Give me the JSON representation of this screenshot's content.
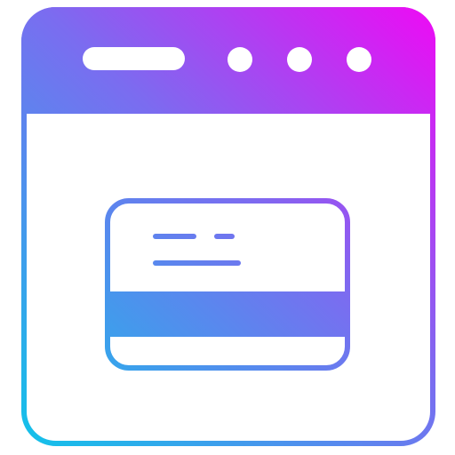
{
  "icon": {
    "name": "browser-window-credit-card-icon",
    "parts": {
      "window": "browser-window-icon",
      "address_bar": "address-bar-pill-icon",
      "dots": [
        "window-dot-icon",
        "window-dot-icon",
        "window-dot-icon"
      ],
      "card": "credit-card-icon"
    }
  },
  "colors": {
    "gradient_start": "#12c2e9",
    "gradient_mid": "#7b6cf0",
    "gradient_end": "#ee0af4",
    "background": "#ffffff"
  }
}
